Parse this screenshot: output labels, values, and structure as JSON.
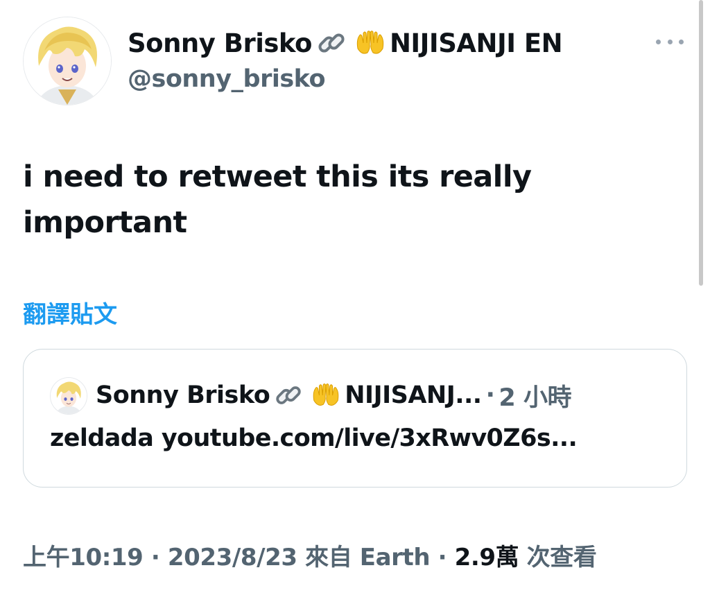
{
  "tweet": {
    "author_display_name": "Sonny Brisko",
    "author_affiliation": "NIJISANJI EN",
    "author_handle": "@sonny_brisko",
    "text": "i need to retweet this its really important",
    "translate_label": "翻譯貼文",
    "emoji_icons": [
      "link-icon",
      "hands-icon"
    ]
  },
  "quoted_tweet": {
    "author_display_name": "Sonny Brisko",
    "author_affiliation_truncated": "NIJISANJ...",
    "time_separator": "·",
    "time_ago": "2 小時",
    "text": "zeldada youtube.com/live/3xRwv0Z6s..."
  },
  "meta": {
    "time": "上午10:19",
    "separator": "·",
    "date": "2023/8/23",
    "source": "來自 Earth",
    "separator2": "·",
    "views_count": "2.9萬",
    "views_label": "次查看"
  },
  "colors": {
    "text_primary": "#0f1419",
    "text_secondary": "#536471",
    "link_blue": "#1d9bf0",
    "border": "#cfd9de"
  }
}
